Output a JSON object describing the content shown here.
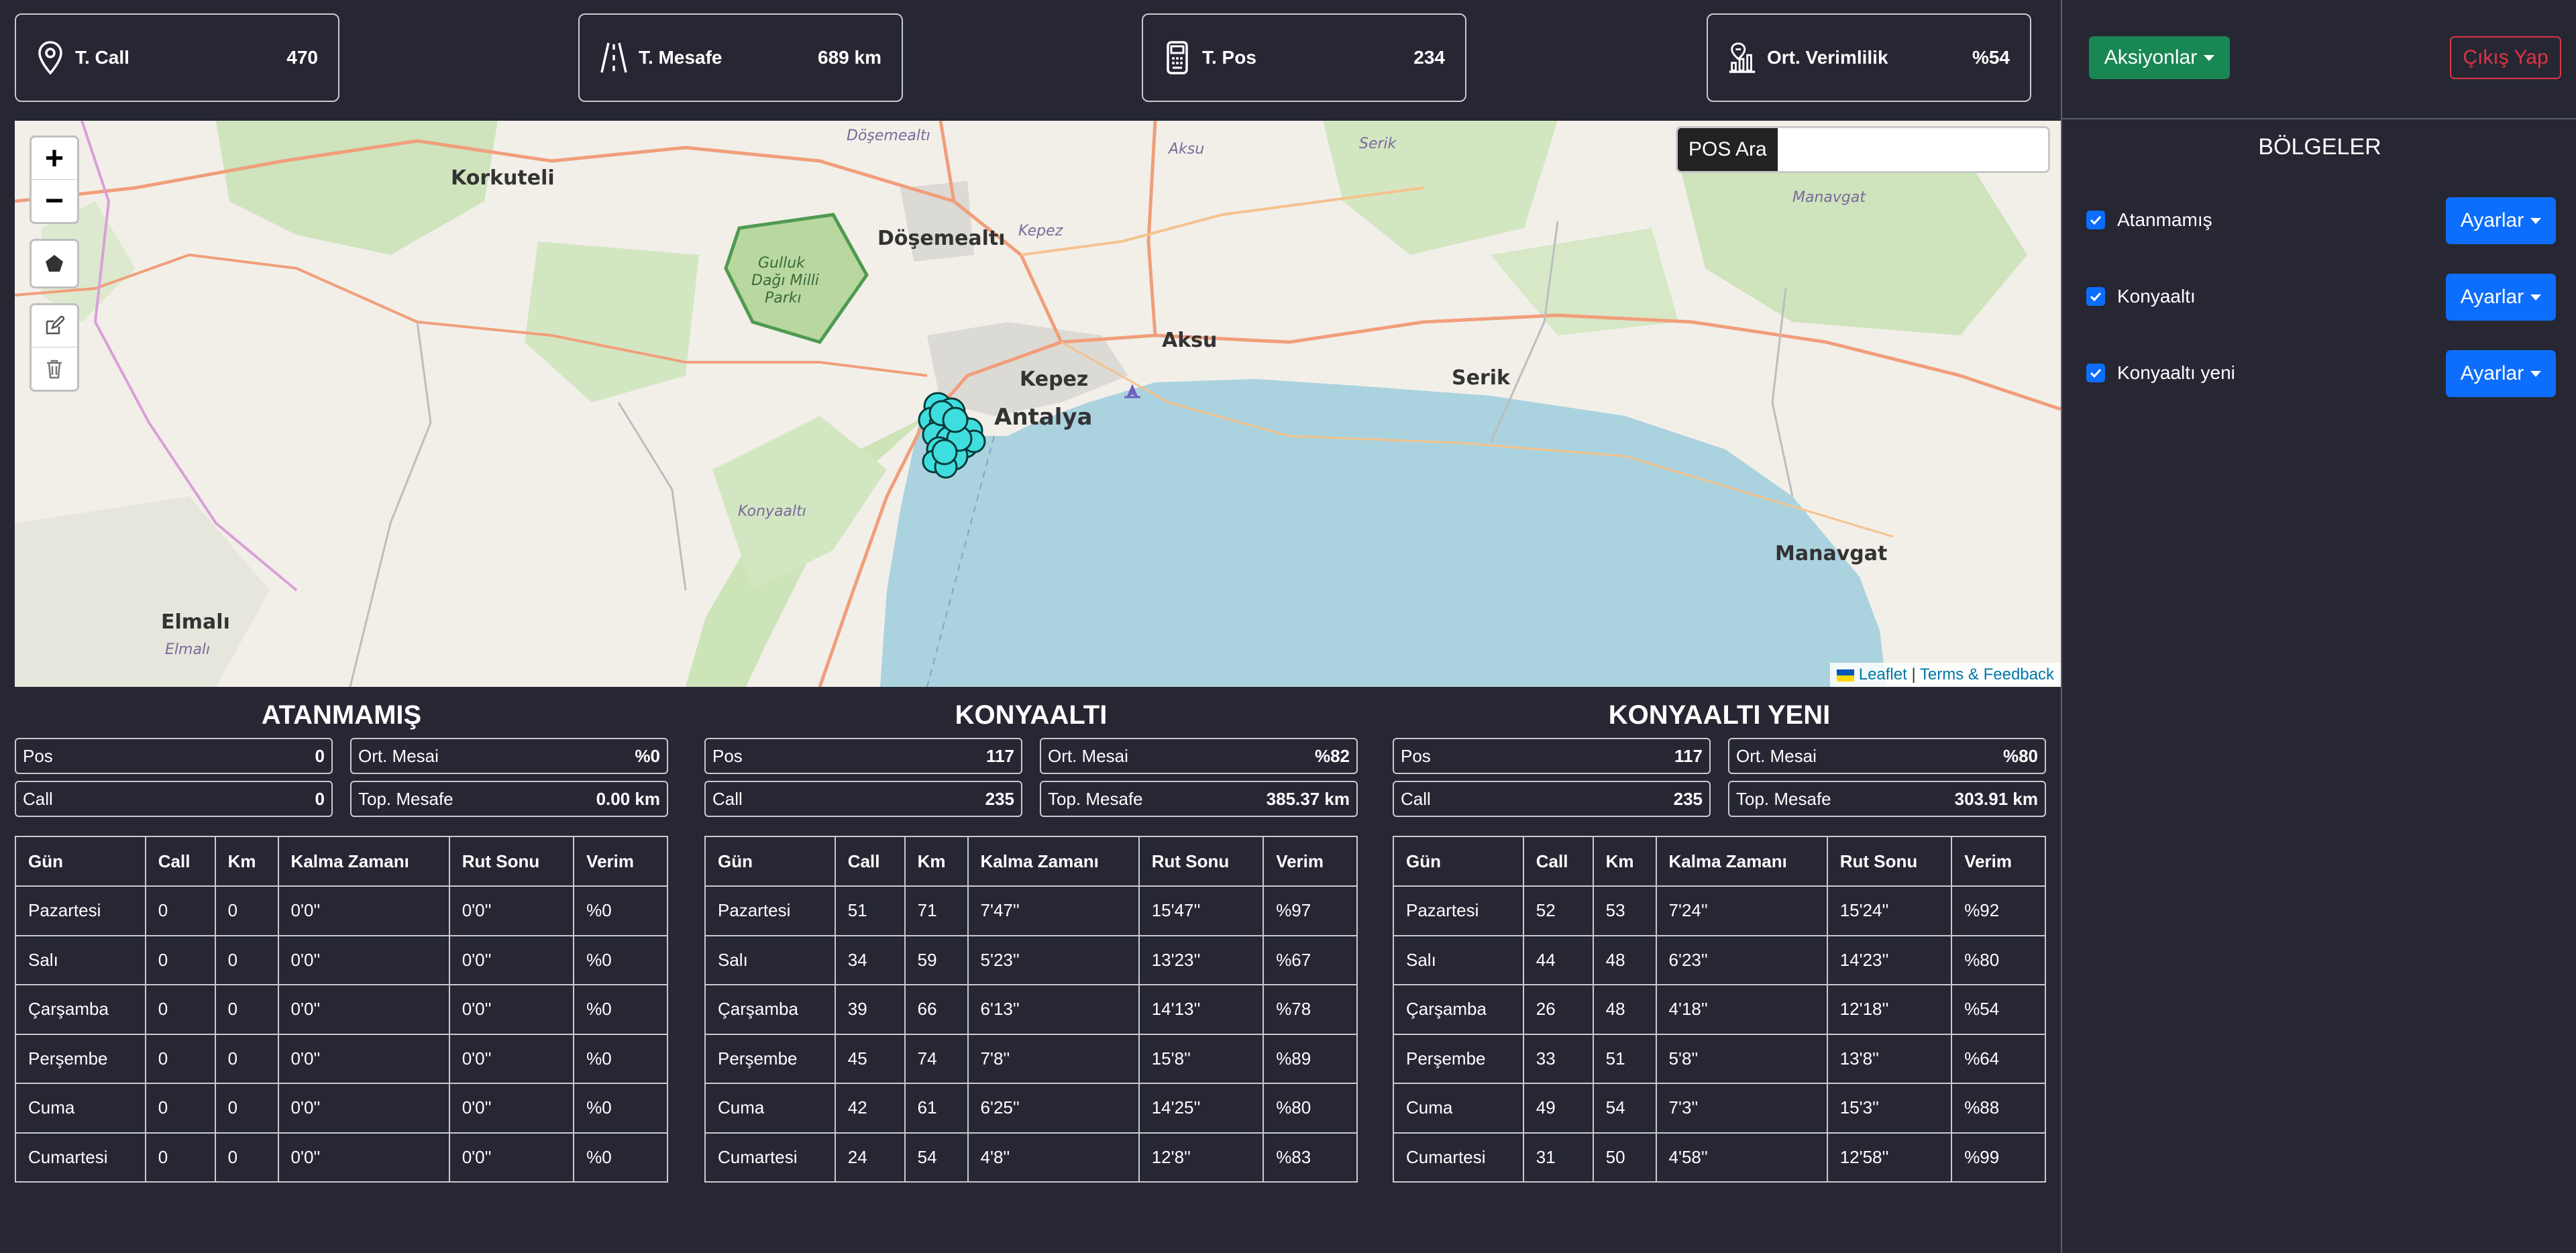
{
  "stats": [
    {
      "label": "T. Call",
      "value": "470",
      "icon": "location-pin-icon"
    },
    {
      "label": "T. Mesafe",
      "value": "689 km",
      "icon": "road-icon"
    },
    {
      "label": "T. Pos",
      "value": "234",
      "icon": "pos-terminal-icon"
    },
    {
      "label": "Ort. Verimlilik",
      "value": "%54",
      "icon": "efficiency-chart-icon"
    }
  ],
  "header": {
    "actions_label": "Aksiyonlar",
    "logout_label": "Çıkış Yap"
  },
  "regions": {
    "title": "BÖLGELER",
    "items": [
      {
        "label": "Atanmamış",
        "checked": true,
        "settings_label": "Ayarlar"
      },
      {
        "label": "Konyaaltı",
        "checked": true,
        "settings_label": "Ayarlar"
      },
      {
        "label": "Konyaaltı yeni",
        "checked": true,
        "settings_label": "Ayarlar"
      }
    ]
  },
  "map": {
    "search_label": "POS Ara",
    "search_value": "",
    "zoom_in": "+",
    "zoom_out": "−",
    "attribution_leaflet": "Leaflet",
    "attribution_sep": "|",
    "attribution_terms": "Terms & Feedback",
    "labels": {
      "korkuteli": "Korkuteli",
      "dosemealti_top": "Döşemealtı",
      "dosemealti": "Döşemealtı",
      "kepez": "Kepez",
      "kepez2": "Kepez",
      "aksu_top": "Aksu",
      "aksu": "Aksu",
      "serik_top": "Serik",
      "serik": "Serik",
      "manavgat_top": "Manavgat",
      "manavgat": "Manavgat",
      "antalya": "Antalya",
      "konyaalti": "Konyaaltı",
      "elmali": "Elmalı",
      "elmali2": "Elmalı",
      "park_line1": "Gulluk",
      "park_line2": "Dağı Milli",
      "park_line3": "Parkı"
    },
    "marker_color": "#3fdede"
  },
  "columns": [
    "Gün",
    "Call",
    "Km",
    "Kalma Zamanı",
    "Rut Sonu",
    "Verim"
  ],
  "panels": [
    {
      "title": "ATANMAMIŞ",
      "pos_label": "Pos",
      "pos": "0",
      "mesai_label": "Ort. Mesai",
      "mesai": "%0",
      "call_label": "Call",
      "call": "0",
      "mesafe_label": "Top. Mesafe",
      "mesafe": "0.00 km",
      "rows": [
        [
          "Pazartesi",
          "0",
          "0",
          "0'0''",
          "0'0''",
          "%0"
        ],
        [
          "Salı",
          "0",
          "0",
          "0'0''",
          "0'0''",
          "%0"
        ],
        [
          "Çarşamba",
          "0",
          "0",
          "0'0''",
          "0'0''",
          "%0"
        ],
        [
          "Perşembe",
          "0",
          "0",
          "0'0''",
          "0'0''",
          "%0"
        ],
        [
          "Cuma",
          "0",
          "0",
          "0'0''",
          "0'0''",
          "%0"
        ],
        [
          "Cumartesi",
          "0",
          "0",
          "0'0''",
          "0'0''",
          "%0"
        ]
      ]
    },
    {
      "title": "KONYAALTI",
      "pos_label": "Pos",
      "pos": "117",
      "mesai_label": "Ort. Mesai",
      "mesai": "%82",
      "call_label": "Call",
      "call": "235",
      "mesafe_label": "Top. Mesafe",
      "mesafe": "385.37 km",
      "rows": [
        [
          "Pazartesi",
          "51",
          "71",
          "7'47''",
          "15'47''",
          "%97"
        ],
        [
          "Salı",
          "34",
          "59",
          "5'23''",
          "13'23''",
          "%67"
        ],
        [
          "Çarşamba",
          "39",
          "66",
          "6'13''",
          "14'13''",
          "%78"
        ],
        [
          "Perşembe",
          "45",
          "74",
          "7'8''",
          "15'8''",
          "%89"
        ],
        [
          "Cuma",
          "42",
          "61",
          "6'25''",
          "14'25''",
          "%80"
        ],
        [
          "Cumartesi",
          "24",
          "54",
          "4'8''",
          "12'8''",
          "%83"
        ]
      ]
    },
    {
      "title": "KONYAALTI YENI",
      "pos_label": "Pos",
      "pos": "117",
      "mesai_label": "Ort. Mesai",
      "mesai": "%80",
      "call_label": "Call",
      "call": "235",
      "mesafe_label": "Top. Mesafe",
      "mesafe": "303.91 km",
      "rows": [
        [
          "Pazartesi",
          "52",
          "53",
          "7'24''",
          "15'24''",
          "%92"
        ],
        [
          "Salı",
          "44",
          "48",
          "6'23''",
          "14'23''",
          "%80"
        ],
        [
          "Çarşamba",
          "26",
          "48",
          "4'18''",
          "12'18''",
          "%54"
        ],
        [
          "Perşembe",
          "33",
          "51",
          "5'8''",
          "13'8''",
          "%64"
        ],
        [
          "Cuma",
          "49",
          "54",
          "7'3''",
          "15'3''",
          "%88"
        ],
        [
          "Cumartesi",
          "31",
          "50",
          "4'58''",
          "12'58''",
          "%99"
        ]
      ]
    }
  ]
}
